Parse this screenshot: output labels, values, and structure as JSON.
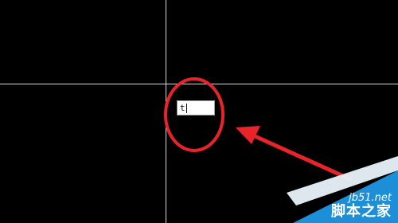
{
  "viewport": {
    "background_color": "#000000",
    "crosshair_color": "#d8d8d8"
  },
  "command_input": {
    "value": "t",
    "cursor": "text-caret"
  },
  "annotation": {
    "highlight_color": "#e8232a",
    "shapes": [
      "highlight-ellipse",
      "pointer-arrow"
    ]
  },
  "watermark": {
    "logo_text": "jb51.net",
    "site_text": "脚本之家",
    "color": "#1d8fd8"
  }
}
